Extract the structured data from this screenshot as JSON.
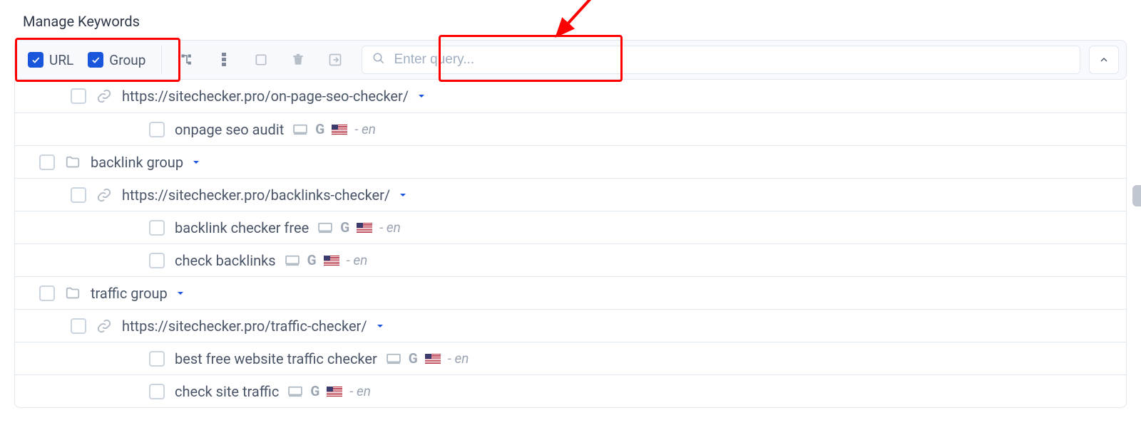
{
  "title": "Manage Keywords",
  "toolbar": {
    "filters": {
      "url_label": "URL",
      "group_label": "Group",
      "url_checked": true,
      "group_checked": true
    },
    "search_placeholder": "Enter query...",
    "icons": [
      "tree-icon",
      "more-vertical-icon",
      "select-all-icon",
      "trash-icon",
      "export-icon"
    ]
  },
  "lang_suffix_sep": " - ",
  "rows": [
    {
      "type": "url",
      "text": "https://sitechecker.pro/on-page-seo-checker/",
      "expandable": true
    },
    {
      "type": "kw",
      "text": "onpage seo audit",
      "lang": "en"
    },
    {
      "type": "group",
      "text": "backlink group",
      "expandable": true
    },
    {
      "type": "url",
      "text": "https://sitechecker.pro/backlinks-checker/",
      "expandable": true
    },
    {
      "type": "kw",
      "text": "backlink checker free",
      "lang": "en"
    },
    {
      "type": "kw",
      "text": "check backlinks",
      "lang": "en"
    },
    {
      "type": "group",
      "text": "traffic group",
      "expandable": true
    },
    {
      "type": "url",
      "text": "https://sitechecker.pro/traffic-checker/",
      "expandable": true
    },
    {
      "type": "kw",
      "text": "best free website traffic checker",
      "lang": "en"
    },
    {
      "type": "kw",
      "text": "check site traffic",
      "lang": "en"
    }
  ]
}
